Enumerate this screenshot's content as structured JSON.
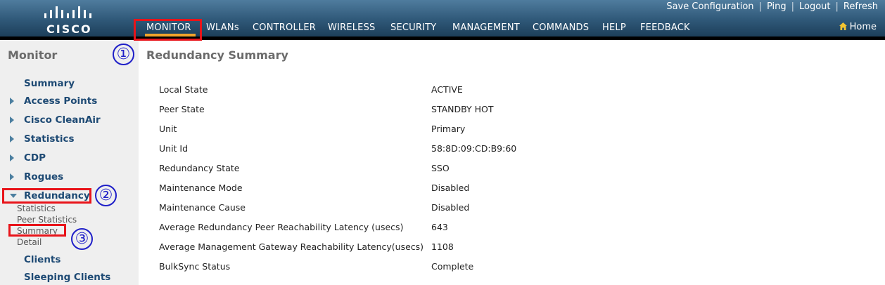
{
  "header": {
    "logo_text": "CISCO",
    "utility_links": [
      "Save Configuration",
      "Ping",
      "Logout",
      "Refresh"
    ],
    "nav_items": [
      "MONITOR",
      "WLANs",
      "CONTROLLER",
      "WIRELESS",
      "SECURITY",
      "MANAGEMENT",
      "COMMANDS",
      "HELP",
      "FEEDBACK"
    ],
    "active_nav": "MONITOR",
    "home_label": "Home",
    "accent_color": "#f2a52c"
  },
  "sidebar": {
    "title": "Monitor",
    "items": [
      {
        "label": "Summary"
      },
      {
        "label": "Access Points"
      },
      {
        "label": "Cisco CleanAir"
      },
      {
        "label": "Statistics"
      },
      {
        "label": "CDP"
      },
      {
        "label": "Rogues"
      },
      {
        "label": "Redundancy"
      },
      {
        "label": "Clients"
      },
      {
        "label": "Sleeping Clients"
      }
    ],
    "redundancy_subitems": [
      "Statistics",
      "Peer Statistics",
      "Summary",
      "Detail"
    ]
  },
  "main": {
    "title": "Redundancy Summary",
    "rows": [
      {
        "label": "Local State",
        "value": "ACTIVE"
      },
      {
        "label": "Peer State",
        "value": "STANDBY HOT"
      },
      {
        "label": "Unit",
        "value": "Primary"
      },
      {
        "label": "Unit Id",
        "value": "58:8D:09:CD:B9:60"
      },
      {
        "label": "Redundancy State",
        "value": "SSO"
      },
      {
        "label": "Maintenance Mode",
        "value": "Disabled"
      },
      {
        "label": "Maintenance Cause",
        "value": "Disabled"
      },
      {
        "label": "Average Redundancy Peer Reachability Latency (usecs)",
        "value": "643"
      },
      {
        "label": "Average Management Gateway Reachability Latency(usecs)",
        "value": "1108"
      },
      {
        "label": "BulkSync Status",
        "value": "Complete"
      }
    ]
  },
  "annotations": {
    "numbers": [
      "①",
      "②",
      "③"
    ],
    "highlight_color": "#e8141a",
    "number_color": "#1f1fc8"
  }
}
